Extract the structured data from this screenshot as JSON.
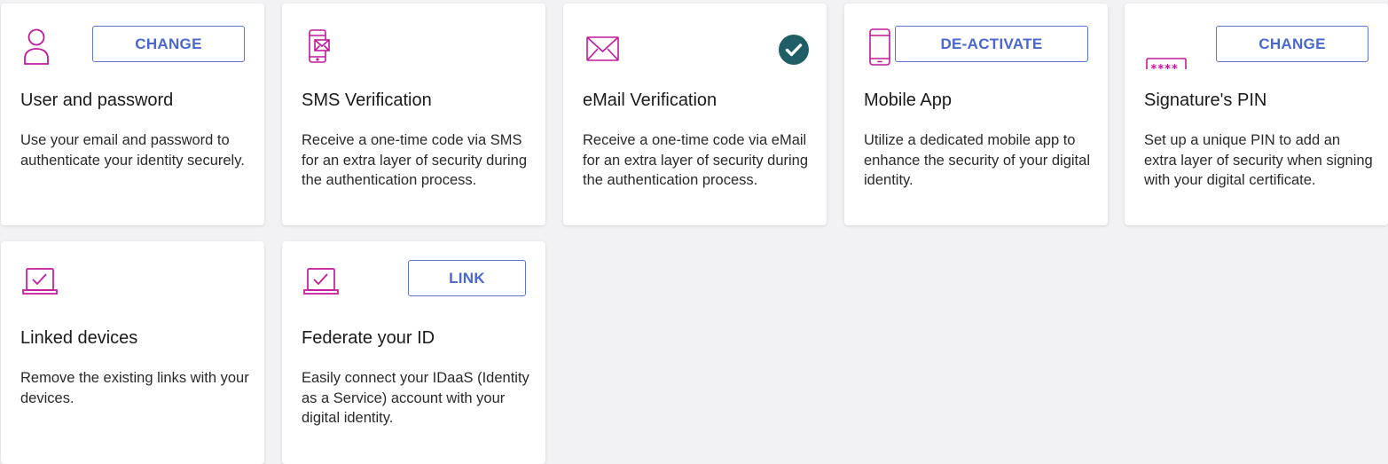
{
  "colors": {
    "icon": "#c2189b",
    "button_border": "#5b74d6",
    "button_text": "#4a66d0",
    "check_badge": "#1f5d67",
    "background": "#f2f2f4"
  },
  "cards": [
    {
      "icon": "user-icon",
      "button": "CHANGE",
      "title": "User and password",
      "description": "Use your email and password to authenticate your identity securely."
    },
    {
      "icon": "sms-phone-icon",
      "title": "SMS Verification",
      "description": "Receive a one-time code via SMS for an extra layer of security during the authentication process."
    },
    {
      "icon": "envelope-icon",
      "status": "verified",
      "title": "eMail Verification",
      "description": "Receive a one-time code via eMail for an extra layer of security during the authentication process."
    },
    {
      "icon": "mobile-phone-icon",
      "button": "DE-ACTIVATE",
      "title": "Mobile App",
      "description": "Utilize a dedicated mobile app to enhance the security of your digital identity."
    },
    {
      "icon": "pin-icon",
      "button": "CHANGE",
      "title": "Signature's PIN",
      "description": "Set up a unique PIN to add an extra layer of security when signing with your digital certificate."
    },
    {
      "icon": "laptop-check-icon",
      "title": "Linked devices",
      "description": "Remove the existing links with your devices."
    },
    {
      "icon": "laptop-check-icon",
      "button": "LINK",
      "title": "Federate your ID",
      "description": "Easily connect your IDaaS (Identity as a Service) account with your digital identity."
    }
  ]
}
